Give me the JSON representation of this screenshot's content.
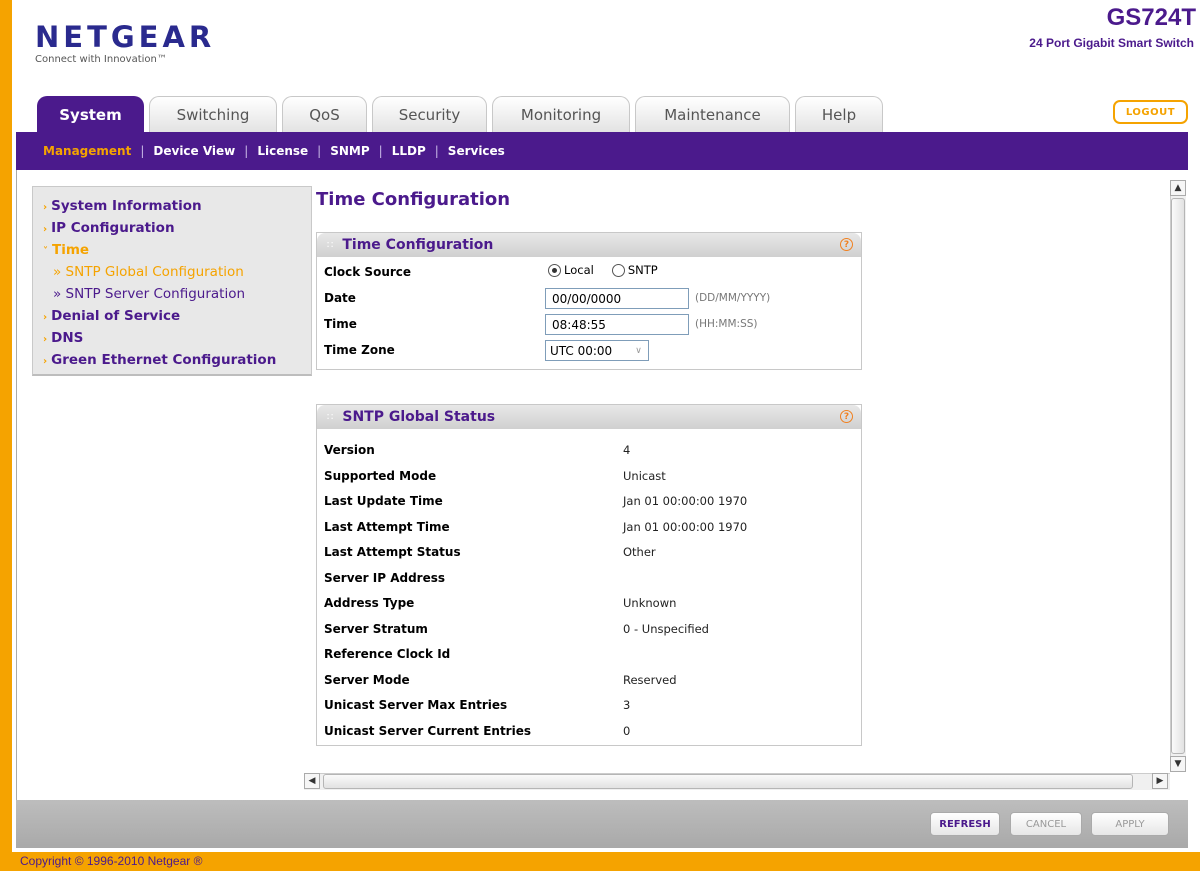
{
  "brand": {
    "logo": "NETGEAR",
    "tagline": "Connect with Innovation™",
    "model": "GS724T",
    "model_desc": "24 Port Gigabit Smart Switch"
  },
  "logout_label": "LOGOUT",
  "tabs": [
    {
      "label": "System",
      "active": true
    },
    {
      "label": "Switching"
    },
    {
      "label": "QoS"
    },
    {
      "label": "Security"
    },
    {
      "label": "Monitoring"
    },
    {
      "label": "Maintenance"
    },
    {
      "label": "Help"
    }
  ],
  "subnav": [
    "Management",
    "Device View",
    "License",
    "SNMP",
    "LLDP",
    "Services"
  ],
  "leftnav": {
    "items": [
      "System Information",
      "IP Configuration",
      "Time",
      "Denial of Service",
      "DNS",
      "Green Ethernet Configuration"
    ],
    "time_children": [
      "» SNTP Global Configuration",
      "» SNTP Server Configuration"
    ]
  },
  "page_title": "Time Configuration",
  "time_config": {
    "title": "Time Configuration",
    "clock_source_label": "Clock Source",
    "clock_source_options": [
      "Local",
      "SNTP"
    ],
    "clock_source_selected": "Local",
    "date_label": "Date",
    "date_value": "00/00/0000",
    "date_hint": "(DD/MM/YYYY)",
    "time_label": "Time",
    "time_value": "08:48:55",
    "time_hint": "(HH:MM:SS)",
    "timezone_label": "Time Zone",
    "timezone_value": "UTC 00:00"
  },
  "sntp_status": {
    "title": "SNTP Global Status",
    "rows": [
      {
        "label": "Version",
        "value": "4"
      },
      {
        "label": "Supported Mode",
        "value": "Unicast"
      },
      {
        "label": "Last Update Time",
        "value": "Jan 01 00:00:00 1970"
      },
      {
        "label": "Last Attempt Time",
        "value": "Jan 01 00:00:00 1970"
      },
      {
        "label": "Last Attempt Status",
        "value": "Other"
      },
      {
        "label": "Server IP Address",
        "value": ""
      },
      {
        "label": "Address Type",
        "value": "Unknown"
      },
      {
        "label": "Server Stratum",
        "value": "0 - Unspecified"
      },
      {
        "label": "Reference Clock Id",
        "value": ""
      },
      {
        "label": "Server Mode",
        "value": "Reserved"
      },
      {
        "label": "Unicast Server Max Entries",
        "value": "3"
      },
      {
        "label": "Unicast Server Current Entries",
        "value": "0"
      }
    ]
  },
  "buttons": {
    "refresh": "REFRESH",
    "cancel": "CANCEL",
    "apply": "APPLY"
  },
  "copyright": "Copyright © 1996-2010 Netgear ®",
  "colors": {
    "accent_orange": "#f5a300",
    "brand_purple": "#4b1a8c"
  }
}
